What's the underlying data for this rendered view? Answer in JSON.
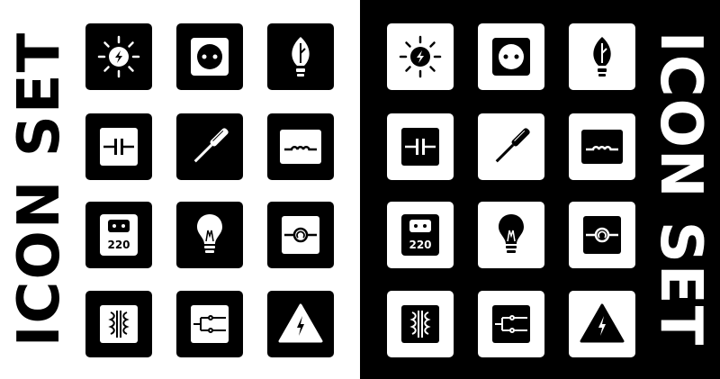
{
  "title": "ICON SET",
  "left_panel": {
    "background": "#ffffff",
    "tiles": [
      {
        "icon": "sun-lightning-icon"
      },
      {
        "icon": "power-socket-icon"
      },
      {
        "icon": "leaf-light-bulb-icon"
      },
      {
        "icon": "capacitor-icon"
      },
      {
        "icon": "screwdriver-icon"
      },
      {
        "icon": "inductor-coil-icon"
      },
      {
        "icon": "voltage-220-socket-icon",
        "label": "220"
      },
      {
        "icon": "light-bulb-icon"
      },
      {
        "icon": "resistor-circle-icon"
      },
      {
        "icon": "transformer-icon"
      },
      {
        "icon": "switch-circuit-icon"
      },
      {
        "icon": "high-voltage-warning-icon"
      }
    ]
  },
  "right_panel": {
    "background": "#000000",
    "tiles": [
      {
        "icon": "sun-lightning-icon"
      },
      {
        "icon": "power-socket-icon"
      },
      {
        "icon": "leaf-light-bulb-icon"
      },
      {
        "icon": "capacitor-icon"
      },
      {
        "icon": "screwdriver-icon"
      },
      {
        "icon": "inductor-coil-icon"
      },
      {
        "icon": "voltage-220-socket-icon",
        "label": "220"
      },
      {
        "icon": "light-bulb-icon"
      },
      {
        "icon": "resistor-circle-icon"
      },
      {
        "icon": "transformer-icon"
      },
      {
        "icon": "switch-circuit-icon"
      },
      {
        "icon": "high-voltage-warning-icon"
      }
    ]
  }
}
